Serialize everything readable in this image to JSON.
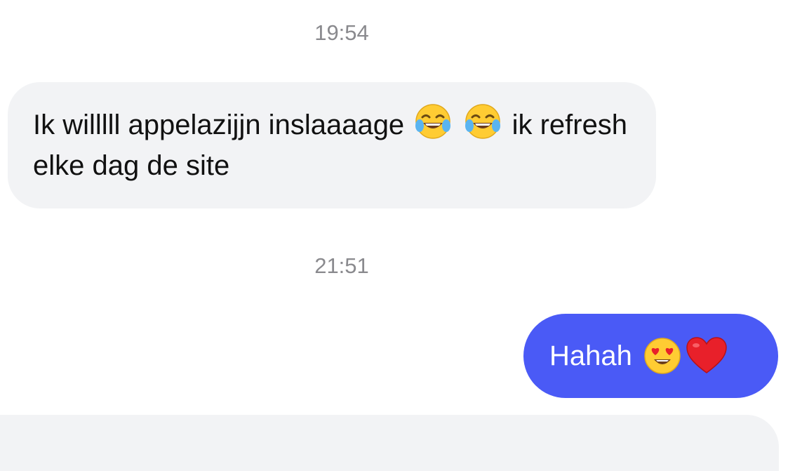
{
  "conversation": {
    "messages": [
      {
        "timestamp": "19:54",
        "direction": "incoming",
        "text_before": "Ik willlll appelazijjn inslaaaage",
        "emoji_1": "face-with-tears-of-joy",
        "emoji_2": "face-with-tears-of-joy",
        "text_after": "ik refresh elke dag de site"
      },
      {
        "timestamp": "21:51",
        "direction": "outgoing",
        "text": "Hahah",
        "emoji_1": "smiling-face-with-heart-eyes",
        "emoji_2": "red-heart"
      }
    ]
  },
  "colors": {
    "incoming_bubble": "#f2f3f5",
    "outgoing_bubble": "#4a5af6",
    "timestamp_text": "#8a8a8e"
  }
}
